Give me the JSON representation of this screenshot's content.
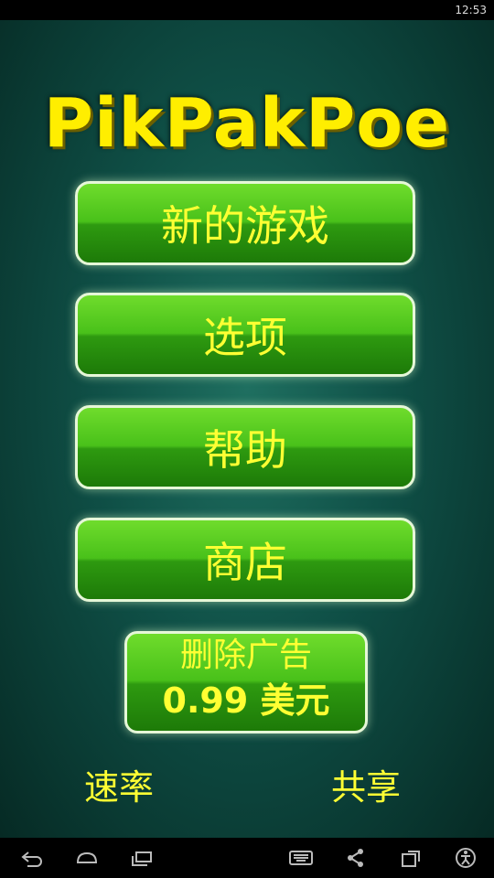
{
  "status_bar": {
    "time": "12:53"
  },
  "app": {
    "logo_text": "PikPakPoe",
    "menu": {
      "new_game": "新的游戏",
      "options": "选项",
      "help": "帮助",
      "shop": "商店"
    },
    "remove_ads": {
      "title": "删除广告",
      "price": "0.99 美元"
    },
    "footer": {
      "rate": "速率",
      "share": "共享"
    }
  },
  "colors": {
    "text_yellow": "#ffff33",
    "button_green": "#49c11a",
    "background_teal": "#0f4f46"
  },
  "nav_icons": [
    "back-icon",
    "home-icon",
    "recent-apps-icon",
    "keyboard-icon",
    "share-icon",
    "screenshot-icon",
    "accessibility-icon"
  ]
}
